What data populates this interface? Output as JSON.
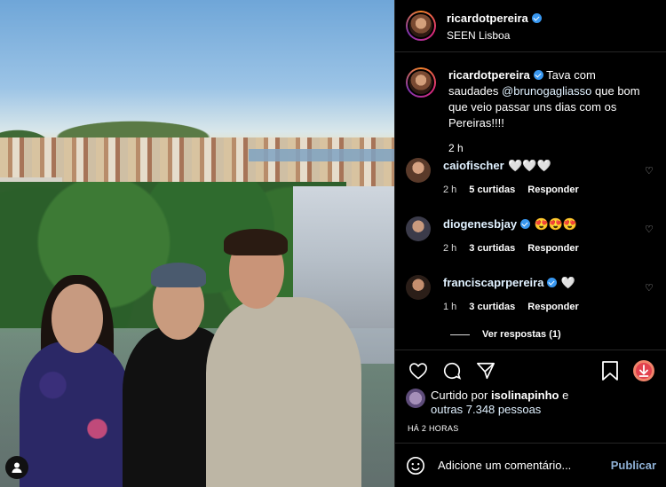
{
  "post_header": {
    "username": "ricardotpereira",
    "location": "SEEN Lisboa"
  },
  "caption": {
    "username": "ricardotpereira",
    "text_before": "Tava com saudades",
    "mention": "@brunogagliasso",
    "text_after": "que bom que veio passar uns dias com os Pereiras!!!!",
    "time": "2 h"
  },
  "comments": [
    {
      "username": "caiofischer",
      "text": "🤍🤍🤍",
      "time": "2 h",
      "likes": "5 curtidas",
      "reply": "Responder"
    },
    {
      "username": "diogenesbjay",
      "text": "😍😍😍",
      "time": "2 h",
      "likes": "3 curtidas",
      "reply": "Responder"
    },
    {
      "username": "franciscaprpereira",
      "text": "🤍",
      "time": "1 h",
      "likes": "3 curtidas",
      "reply": "Responder"
    }
  ],
  "view_replies": "Ver respostas (1)",
  "likes": {
    "prefix": "Curtido por",
    "user": "isolinapinho",
    "conj": "e",
    "others": "outras 7.348 pessoas"
  },
  "posted_ago": "HÁ 2 HORAS",
  "add_comment": {
    "placeholder": "Adicione um comentário...",
    "post_label": "Publicar"
  },
  "colors": {
    "background": "#000000",
    "verified": "#3897f0",
    "link": "#e0f1ff",
    "post_button": "#8fb1d6"
  }
}
